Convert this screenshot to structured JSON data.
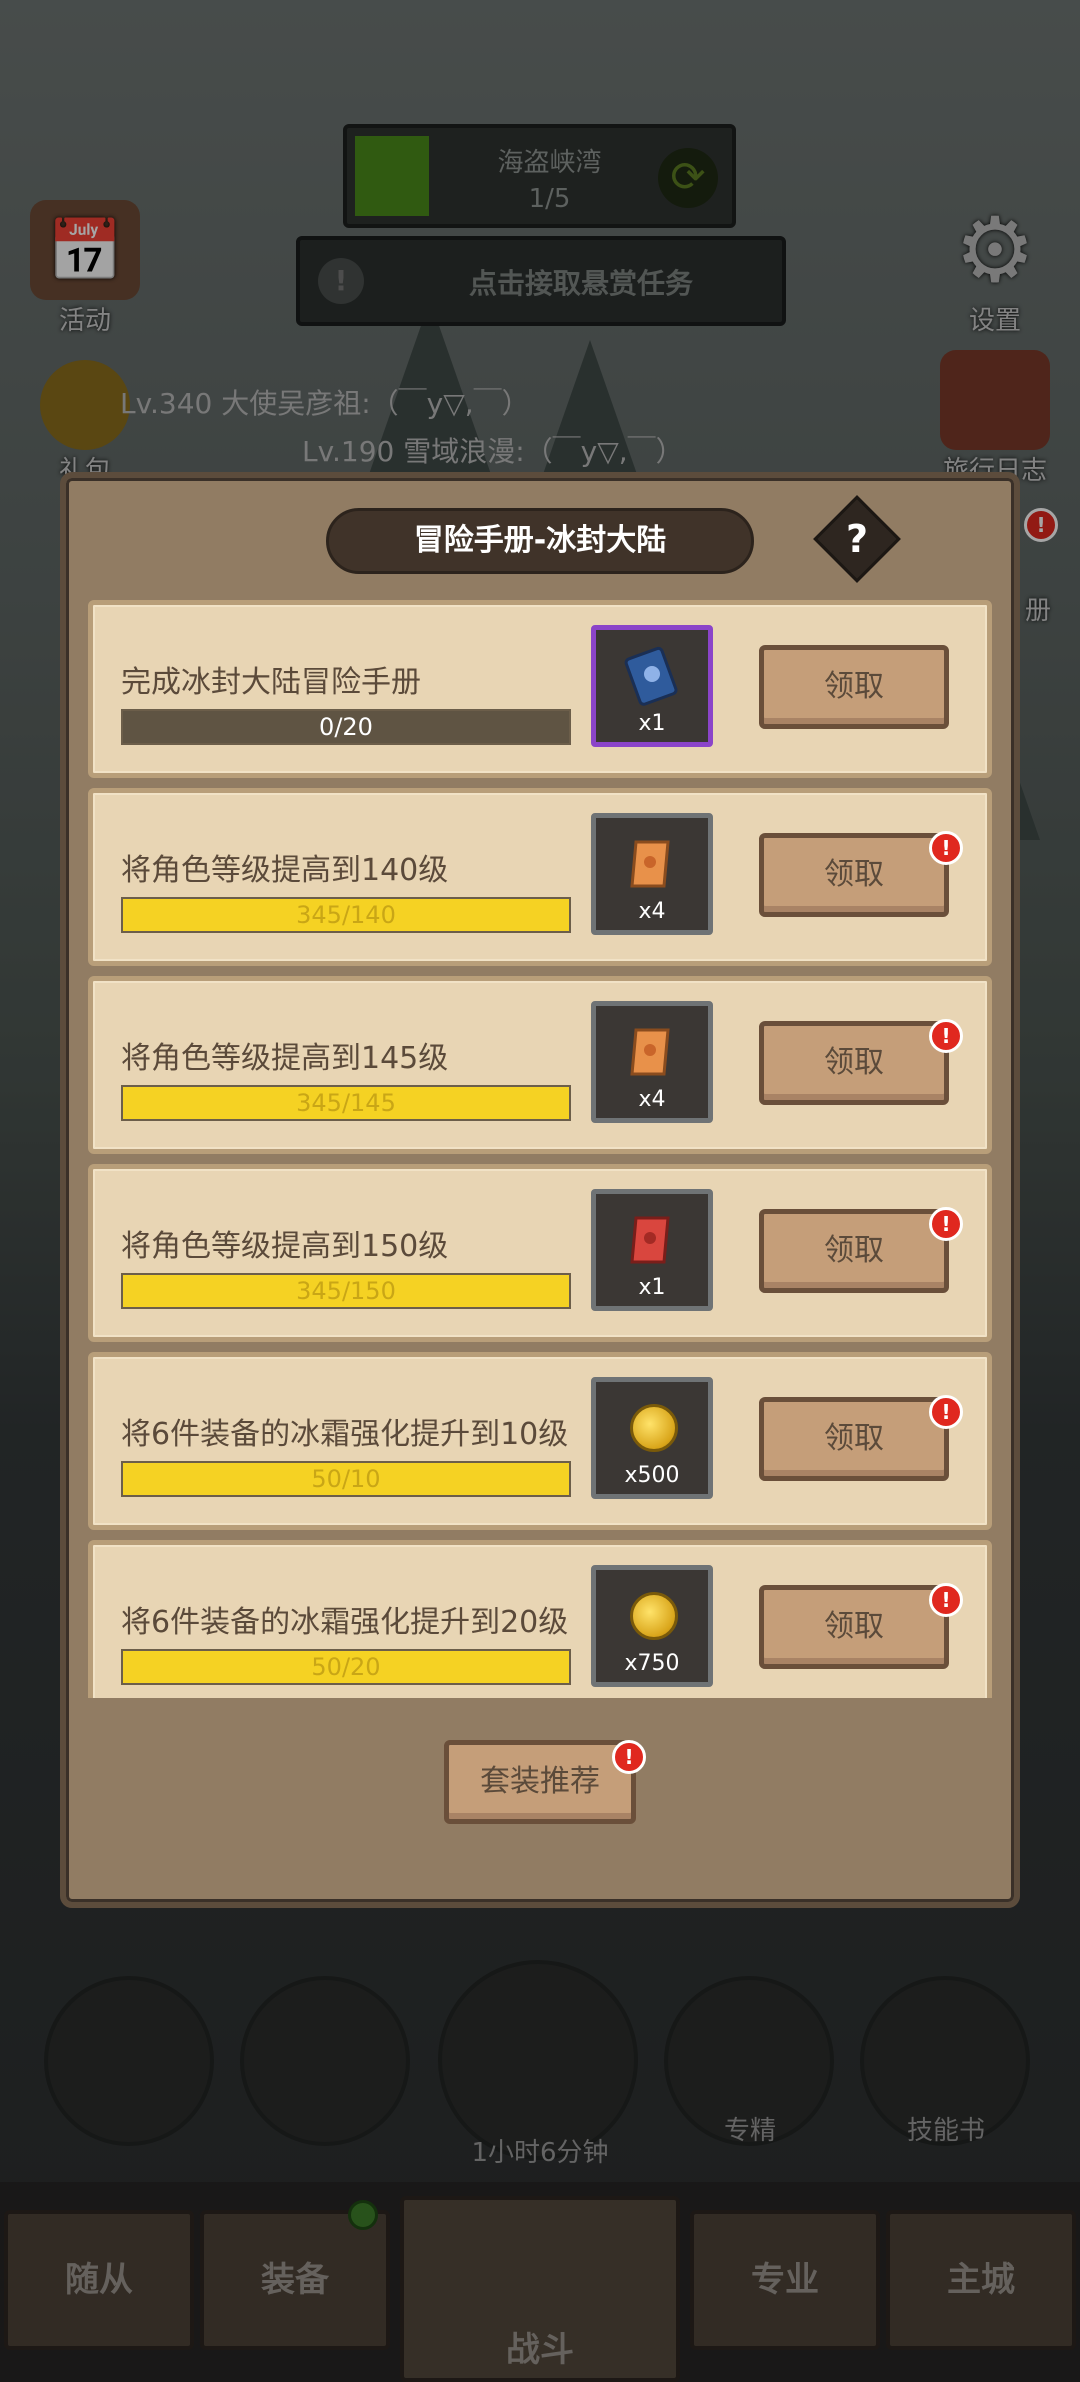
{
  "top": {
    "map_name": "海盗峡湾",
    "map_progress": "1/5",
    "bounty_text": "点击接取悬赏任务"
  },
  "side": {
    "activity": "活动",
    "settings": "设置",
    "gift": "礼包",
    "journal": "旅行日志",
    "manual_partial": "册"
  },
  "chat": {
    "line1": "Lv.340 大使吴彦祖:（￣y▽,￣）",
    "line2": "Lv.190 雪域浪漫:（￣y▽,￣）"
  },
  "modal": {
    "title": "冒险手册-冰封大陆",
    "help": "?",
    "suit_button": "套装推荐"
  },
  "tasks": [
    {
      "title": "完成冰封大陆冒险手册",
      "progress_text": "0/20",
      "progress": 0.0,
      "reward_qty": "x1",
      "reward_icon": "blue-book-icon",
      "claim": "领取",
      "alert": false
    },
    {
      "title": "将角色等级提高到140级",
      "progress_text": "345/140",
      "progress": 1.0,
      "reward_qty": "x4",
      "reward_icon": "orange-scroll-icon",
      "claim": "领取",
      "alert": true
    },
    {
      "title": "将角色等级提高到145级",
      "progress_text": "345/145",
      "progress": 1.0,
      "reward_qty": "x4",
      "reward_icon": "orange-scroll-icon",
      "claim": "领取",
      "alert": true
    },
    {
      "title": "将角色等级提高到150级",
      "progress_text": "345/150",
      "progress": 1.0,
      "reward_qty": "x1",
      "reward_icon": "red-scroll-icon",
      "claim": "领取",
      "alert": true
    },
    {
      "title": "将6件装备的冰霜强化提升到10级",
      "progress_text": "50/10",
      "progress": 1.0,
      "reward_qty": "x500",
      "reward_icon": "gold-coin-icon",
      "claim": "领取",
      "alert": true
    },
    {
      "title": "将6件装备的冰霜强化提升到20级",
      "progress_text": "50/20",
      "progress": 1.0,
      "reward_qty": "x750",
      "reward_icon": "gold-coin-icon",
      "claim": "领取",
      "alert": true
    }
  ],
  "bottom": {
    "chest_timer": "1小时6分钟",
    "specialty": "专精",
    "skill_book": "技能书",
    "nav": [
      "随从",
      "装备",
      "战斗",
      "专业",
      "主城"
    ]
  },
  "colors": {
    "progress_yellow": "#f5d223",
    "alert_red": "#e0281f",
    "button_tan": "#c59e79",
    "panel_cream": "#e8d5b4"
  }
}
